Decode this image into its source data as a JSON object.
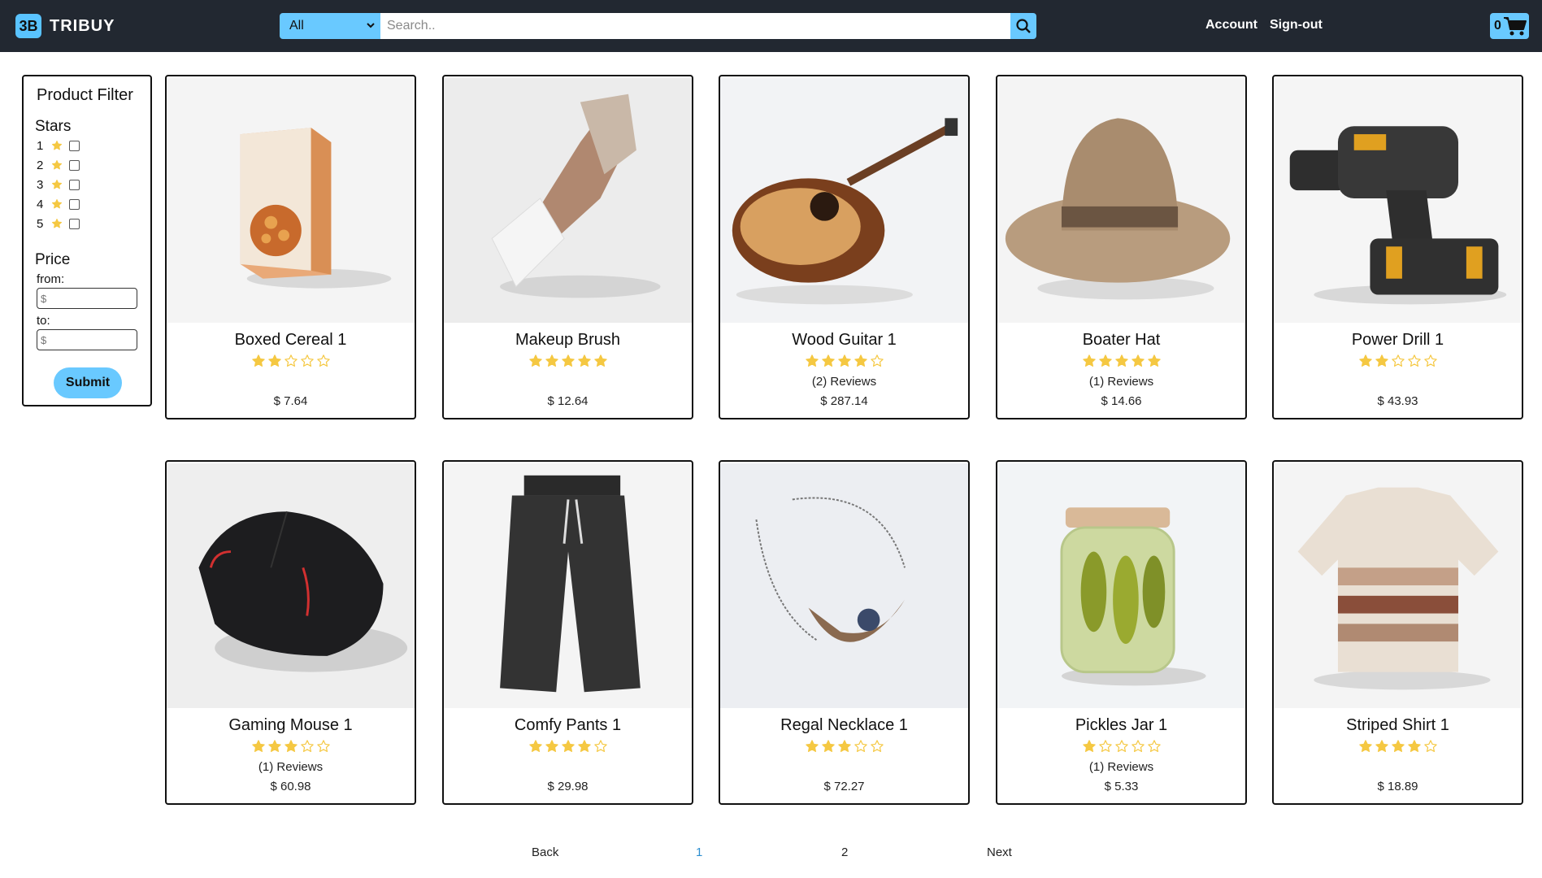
{
  "header": {
    "logo_badge": "3B",
    "logo_text": "TRIBUY",
    "search_category": "All",
    "search_placeholder": "Search..",
    "account": "Account",
    "signout": "Sign-out",
    "cart_count": "0",
    "accent": "#69c9ff",
    "bar_color": "#222831"
  },
  "filter": {
    "title": "Product Filter",
    "stars_heading": "Stars",
    "star_options": [
      "1",
      "2",
      "3",
      "4",
      "5"
    ],
    "price_heading": "Price",
    "from_label": "from:",
    "to_label": "to:",
    "from_placeholder": "$",
    "to_placeholder": "$",
    "submit": "Submit"
  },
  "products": [
    {
      "name": "Boxed Cereal 1",
      "rating": 2,
      "reviews": "",
      "price": "$ 7.64"
    },
    {
      "name": "Makeup Brush",
      "rating": 5,
      "reviews": "",
      "price": "$ 12.64"
    },
    {
      "name": "Wood Guitar 1",
      "rating": 4,
      "reviews": "(2) Reviews",
      "price": "$ 287.14"
    },
    {
      "name": "Boater Hat",
      "rating": 5,
      "reviews": "(1) Reviews",
      "price": "$ 14.66"
    },
    {
      "name": "Power Drill 1",
      "rating": 2,
      "reviews": "",
      "price": "$ 43.93"
    },
    {
      "name": "Gaming Mouse 1",
      "rating": 3,
      "reviews": "(1) Reviews",
      "price": "$ 60.98"
    },
    {
      "name": "Comfy Pants 1",
      "rating": 4,
      "reviews": "",
      "price": "$ 29.98"
    },
    {
      "name": "Regal Necklace 1",
      "rating": 3,
      "reviews": "",
      "price": "$ 72.27"
    },
    {
      "name": "Pickles Jar 1",
      "rating": 1,
      "reviews": "(1) Reviews",
      "price": "$ 5.33"
    },
    {
      "name": "Striped Shirt 1",
      "rating": 4,
      "reviews": "",
      "price": "$ 18.89"
    }
  ],
  "pagination": {
    "back": "Back",
    "pages": [
      "1",
      "2"
    ],
    "current": "1",
    "next": "Next"
  }
}
